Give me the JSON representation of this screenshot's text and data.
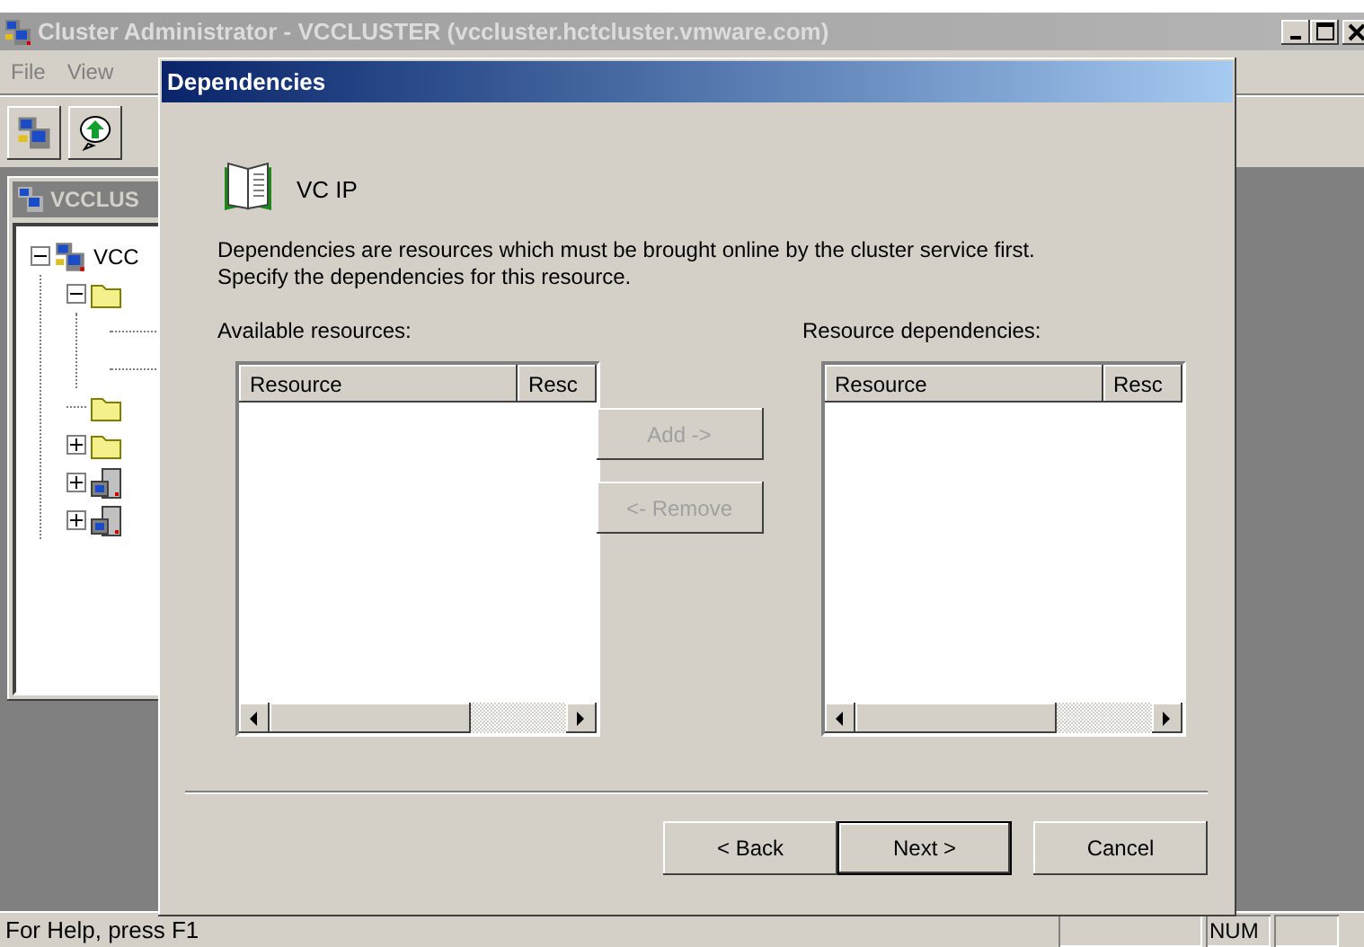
{
  "main_window": {
    "title": "Cluster Administrator - VCCLUSTER (vccluster.hctcluster.vmware.com)",
    "active": false,
    "menu": [
      {
        "label": "File"
      },
      {
        "label": "View"
      }
    ],
    "child_window": {
      "title": "VCCLUS",
      "tree": [
        {
          "kind": "cluster",
          "label": "VCC",
          "expanded": true,
          "children": [
            {
              "kind": "folder",
              "expanded": true,
              "children": [
                {
                  "kind": "hidden"
                },
                {
                  "kind": "hidden"
                }
              ]
            },
            {
              "kind": "folder"
            },
            {
              "kind": "folder",
              "expanded": false
            },
            {
              "kind": "server",
              "expanded": false
            },
            {
              "kind": "server",
              "expanded": false
            }
          ]
        }
      ]
    }
  },
  "dialog": {
    "title": "Dependencies",
    "resource_name": "VC IP",
    "description": "Dependencies are resources which must be brought online by the cluster service first.\nSpecify the dependencies for this resource.",
    "lists": [
      {
        "label": "Available resources:",
        "columns": [
          "Resource",
          "Resc"
        ]
      },
      {
        "label": "Resource dependencies:",
        "columns": [
          "Resource",
          "Resc"
        ]
      }
    ],
    "middle_buttons": [
      {
        "label": "Add ->",
        "disabled": true
      },
      {
        "label": "<- Remove",
        "disabled": true
      }
    ],
    "buttons": [
      {
        "label": "< Back",
        "default": false
      },
      {
        "label": "Next >",
        "default": true
      },
      {
        "label": "Cancel",
        "default": false
      }
    ]
  },
  "status_bar": {
    "text": "For Help, press F1",
    "num_indicator": "NUM"
  }
}
